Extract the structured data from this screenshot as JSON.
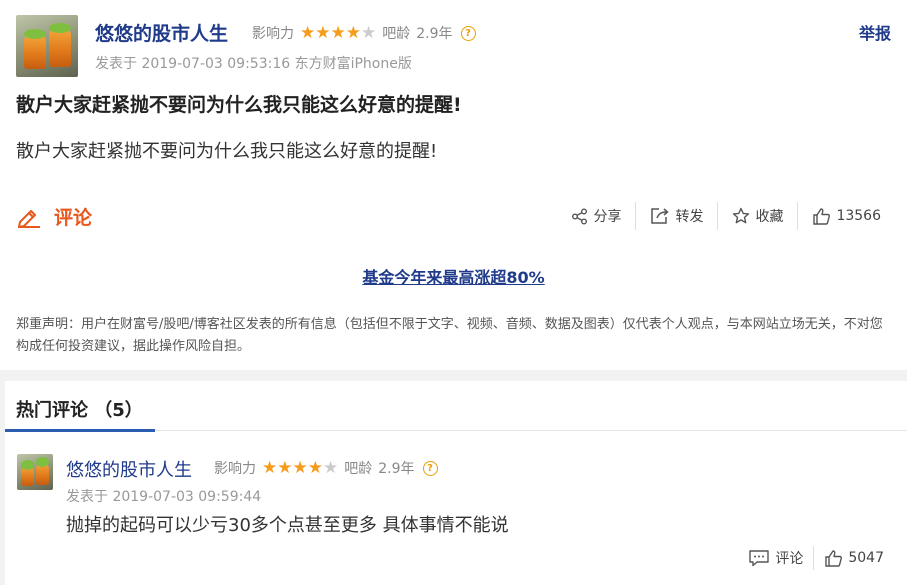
{
  "post": {
    "author": "悠悠的股市人生",
    "influence_label": "影响力",
    "rating": 4,
    "rating_max": 5,
    "bar_age_label": "吧龄",
    "bar_age": "2.9年",
    "help_icon": "help-icon",
    "report_label": "举报",
    "posted_text": "发表于 2019-07-03 09:53:16 东方财富iPhone版",
    "title": "散户大家赶紧抛不要问为什么我只能这么好意的提醒!",
    "body": "散户大家赶紧抛不要问为什么我只能这么好意的提醒!",
    "comment_label": "评论",
    "actions": {
      "share": "分享",
      "forward": "转发",
      "favorite": "收藏",
      "likes": "13566"
    },
    "promo_link": "基金今年来最高涨超80%",
    "disclaimer": "郑重声明：用户在财富号/股吧/博客社区发表的所有信息（包括但不限于文字、视频、音频、数据及图表）仅代表个人观点，与本网站立场无关，不对您构成任何投资建议，据此操作风险自担。"
  },
  "hot_comments": {
    "title": "热门评论 （5）",
    "items": [
      {
        "author": "悠悠的股市人生",
        "influence_label": "影响力",
        "rating": 4,
        "bar_age_label": "吧龄",
        "bar_age": "2.9年",
        "posted_text": "发表于 2019-07-03 09:59:44",
        "text": "抛掉的起码可以少亏30多个点甚至更多 具体事情不能说",
        "reply_label": "评论",
        "likes": "5047"
      }
    ]
  },
  "colors": {
    "link_blue": "#1f3b8a",
    "accent_orange": "#e8571b",
    "star": "#f59c1a",
    "tab_underline": "#2a5db0"
  }
}
